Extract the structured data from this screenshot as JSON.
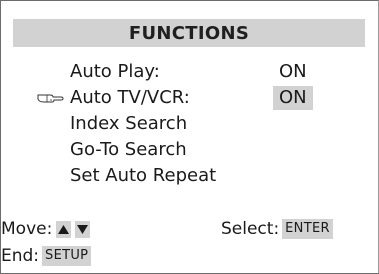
{
  "title": "FUNCTIONS",
  "menu": [
    {
      "label": "Auto Play:",
      "value": "ON"
    },
    {
      "label": "Auto TV/VCR:",
      "value": "ON"
    },
    {
      "label": "Index Search"
    },
    {
      "label": "Go-To Search"
    },
    {
      "label": "Set Auto Repeat"
    }
  ],
  "selected_item": "Auto TV/VCR:",
  "footer": {
    "move_label": "Move:",
    "select_label": "Select:",
    "select_key": "ENTER",
    "end_label": "End:",
    "end_key": "SETUP"
  },
  "icons": {
    "pointer": "pointing-hand-icon",
    "up": "up-triangle-icon",
    "down": "down-triangle-icon"
  },
  "colors": {
    "highlight": "#d2d2d2",
    "text": "#1a1a1a",
    "border": "#6b6b6b"
  }
}
